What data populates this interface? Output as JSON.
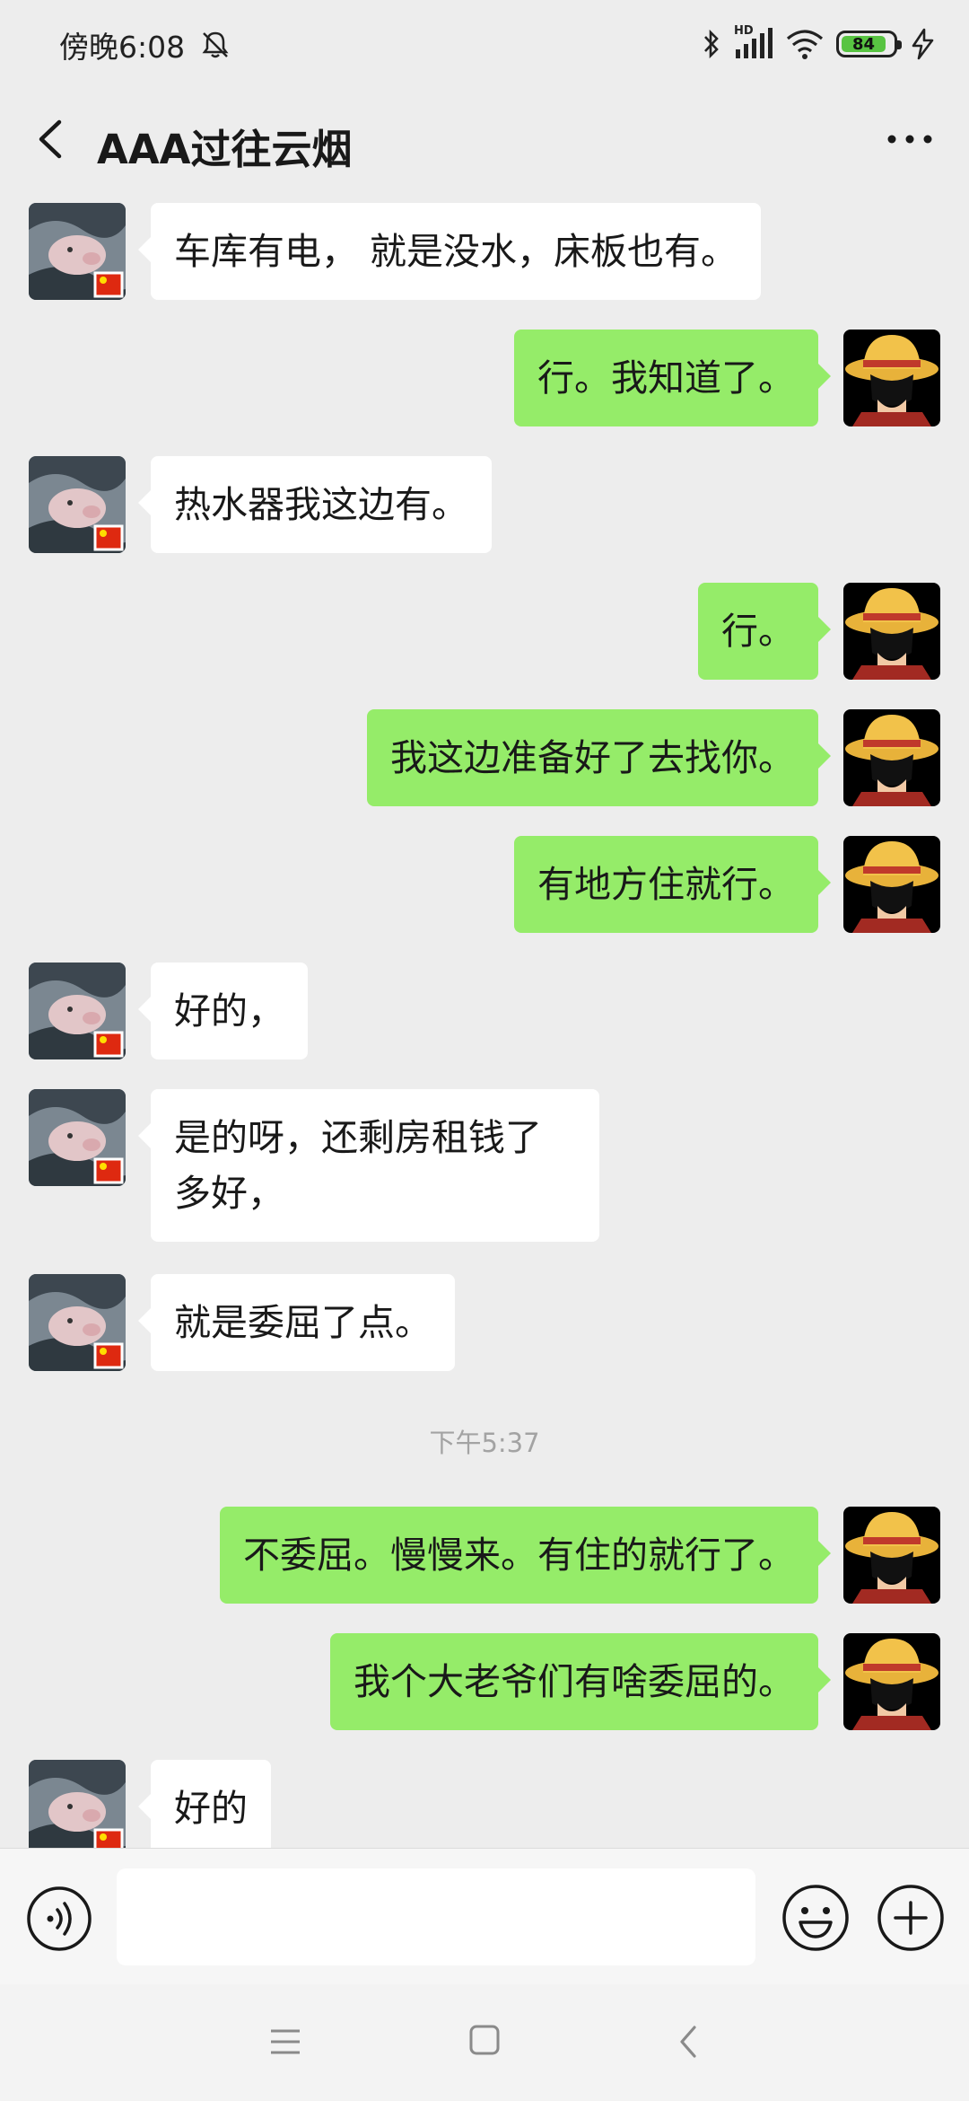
{
  "status_bar": {
    "time": "傍晚6:08",
    "network": "HD",
    "battery": "84"
  },
  "header": {
    "title": "AAA过往云烟"
  },
  "messages": [
    {
      "side": "left",
      "text": "车库有电，  就是没水，床板也有。"
    },
    {
      "side": "right",
      "text": "行。我知道了。"
    },
    {
      "side": "left",
      "text": "热水器我这边有。"
    },
    {
      "side": "right",
      "text": "行。"
    },
    {
      "side": "right",
      "text": "我这边准备好了去找你。"
    },
    {
      "side": "right",
      "text": "有地方住就行。"
    },
    {
      "side": "left",
      "text": "好的，"
    },
    {
      "side": "left",
      "text": "是的呀，还剩房租钱了多好，"
    },
    {
      "side": "left",
      "text": "就是委屈了点。"
    },
    {
      "side": "right",
      "text": "不委屈。慢慢来。有住的就行了。"
    },
    {
      "side": "right",
      "text": "我个大老爷们有啥委屈的。"
    },
    {
      "side": "left",
      "text": "好的"
    }
  ],
  "time_divider": "下午5:37",
  "input": {
    "value": "",
    "placeholder": ""
  },
  "colors": {
    "background": "#ededed",
    "sent_bubble": "#95ec69",
    "received_bubble": "#ffffff",
    "battery": "#58c442"
  },
  "icons": {
    "status": [
      "bell-off-icon",
      "bluetooth-icon",
      "signal-icon",
      "wifi-icon",
      "battery-icon",
      "charging-icon"
    ],
    "header": [
      "back-icon",
      "more-icon"
    ],
    "input": [
      "voice-icon",
      "emoji-icon",
      "plus-icon"
    ],
    "nav": [
      "menu-icon",
      "home-icon",
      "nav-back-icon"
    ]
  }
}
